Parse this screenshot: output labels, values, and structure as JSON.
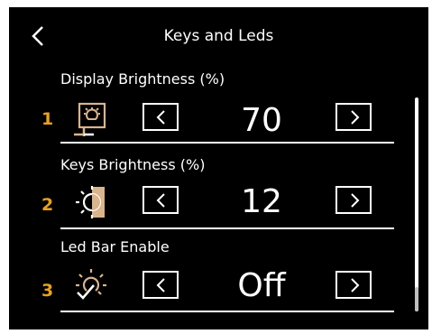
{
  "header": {
    "title": "Keys and Leds",
    "back_icon": "chevron-left-icon"
  },
  "accent_color": "#e8a21a",
  "rows": [
    {
      "number": "1",
      "label": "Display Brightness (%)",
      "value": "70",
      "icon": "display-brightness-icon"
    },
    {
      "number": "2",
      "label": "Keys Brightness (%)",
      "value": "12",
      "icon": "keys-brightness-icon"
    },
    {
      "number": "3",
      "label": "Led Bar Enable",
      "value": "Off",
      "icon": "led-bar-icon"
    }
  ],
  "controls": {
    "decrease_icon": "chevron-left-icon",
    "increase_icon": "chevron-right-icon"
  }
}
